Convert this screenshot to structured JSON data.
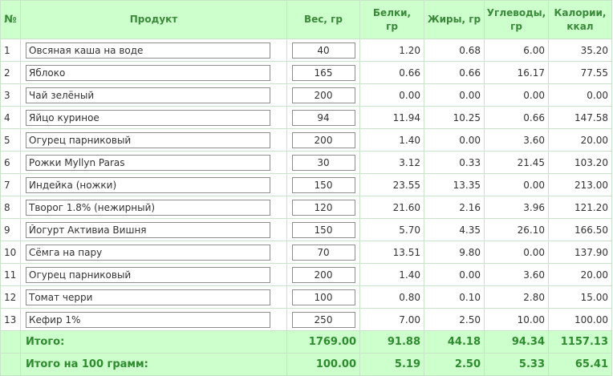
{
  "headers": {
    "num": "№",
    "product": "Продукт",
    "weight": "Вес, гр",
    "protein_l1": "Белки,",
    "protein_l2": "гр",
    "fat": "Жиры, гр",
    "carbs_l1": "Углеводы,",
    "carbs_l2": "гр",
    "kcal_l1": "Калории,",
    "kcal_l2": "ккал"
  },
  "rows": [
    {
      "n": "1",
      "product": "Овсяная каша на воде",
      "weight": "40",
      "protein": "1.20",
      "fat": "0.68",
      "carbs": "6.00",
      "kcal": "35.20"
    },
    {
      "n": "2",
      "product": "Яблоко",
      "weight": "165",
      "protein": "0.66",
      "fat": "0.66",
      "carbs": "16.17",
      "kcal": "77.55"
    },
    {
      "n": "3",
      "product": "Чай зелёный",
      "weight": "200",
      "protein": "0.00",
      "fat": "0.00",
      "carbs": "0.00",
      "kcal": "0.00"
    },
    {
      "n": "4",
      "product": "Яйцо куриное",
      "weight": "94",
      "protein": "11.94",
      "fat": "10.25",
      "carbs": "0.66",
      "kcal": "147.58"
    },
    {
      "n": "5",
      "product": "Огурец парниковый",
      "weight": "200",
      "protein": "1.40",
      "fat": "0.00",
      "carbs": "3.60",
      "kcal": "20.00"
    },
    {
      "n": "6",
      "product": "Рожки Myllyn Paras",
      "weight": "30",
      "protein": "3.12",
      "fat": "0.33",
      "carbs": "21.45",
      "kcal": "103.20"
    },
    {
      "n": "7",
      "product": "Индейка (ножки)",
      "weight": "150",
      "protein": "23.55",
      "fat": "13.35",
      "carbs": "0.00",
      "kcal": "213.00"
    },
    {
      "n": "8",
      "product": "Творог 1.8% (нежирный)",
      "weight": "120",
      "protein": "21.60",
      "fat": "2.16",
      "carbs": "3.96",
      "kcal": "121.20"
    },
    {
      "n": "9",
      "product": "Йогурт Активиа Вишня",
      "weight": "150",
      "protein": "5.70",
      "fat": "4.35",
      "carbs": "26.10",
      "kcal": "166.50"
    },
    {
      "n": "10",
      "product": "Сёмга на пару",
      "weight": "70",
      "protein": "13.51",
      "fat": "9.80",
      "carbs": "0.00",
      "kcal": "137.90"
    },
    {
      "n": "11",
      "product": "Огурец парниковый",
      "weight": "200",
      "protein": "1.40",
      "fat": "0.00",
      "carbs": "3.60",
      "kcal": "20.00"
    },
    {
      "n": "12",
      "product": "Томат черри",
      "weight": "100",
      "protein": "0.80",
      "fat": "0.10",
      "carbs": "2.80",
      "kcal": "15.00"
    },
    {
      "n": "13",
      "product": "Кефир 1%",
      "weight": "250",
      "protein": "7.00",
      "fat": "2.50",
      "carbs": "10.00",
      "kcal": "100.00"
    }
  ],
  "total": {
    "label": "Итого:",
    "weight": "1769.00",
    "protein": "91.88",
    "fat": "44.18",
    "carbs": "94.34",
    "kcal": "1157.13"
  },
  "per100": {
    "label": "Итого на 100 грамм:",
    "weight": "100.00",
    "protein": "5.19",
    "fat": "2.50",
    "carbs": "5.33",
    "kcal": "65.41"
  }
}
